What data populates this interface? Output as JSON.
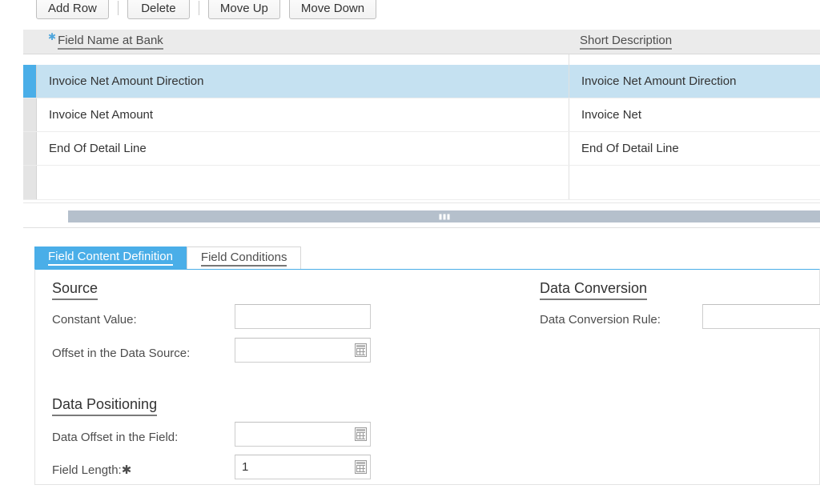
{
  "toolbar": {
    "buttons": [
      {
        "label": "Add Row",
        "name": "add-row-button"
      },
      {
        "label": "Delete",
        "name": "delete-button"
      },
      {
        "label": "Move Up",
        "name": "move-up-button"
      },
      {
        "label": "Move Down",
        "name": "move-down-button"
      }
    ]
  },
  "table": {
    "columns": [
      {
        "label": "Field Name at Bank",
        "required": true
      },
      {
        "label": "Short Description",
        "required": false
      }
    ],
    "rows": [
      {
        "field_name": "Invoice Net Amount Direction",
        "short_description": "Invoice Net Amount Direction",
        "selected": true
      },
      {
        "field_name": "Invoice Net Amount",
        "short_description": "Invoice Net",
        "selected": false
      },
      {
        "field_name": "End Of Detail Line",
        "short_description": "End Of Detail Line",
        "selected": false
      },
      {
        "field_name": "",
        "short_description": "",
        "selected": false
      }
    ],
    "scrollbar": {
      "orientation": "horizontal"
    }
  },
  "tabs": [
    {
      "label": "Field Content Definition",
      "active": true
    },
    {
      "label": "Field Conditions",
      "active": false
    }
  ],
  "form": {
    "source": {
      "title": "Source",
      "constant_value": {
        "label": "Constant Value:",
        "value": "",
        "has_value_help": false
      },
      "offset_in_data_source": {
        "label": "Offset in the Data Source:",
        "value": "",
        "has_value_help": true
      }
    },
    "data_conversion": {
      "title": "Data Conversion",
      "rule": {
        "label": "Data Conversion Rule:",
        "value": "",
        "has_value_help": false
      }
    },
    "data_positioning": {
      "title": "Data Positioning",
      "data_offset_in_field": {
        "label": "Data Offset in the Field:",
        "value": "",
        "has_value_help": true
      },
      "field_length": {
        "label": "Field Length:",
        "value": "1",
        "required": true,
        "has_value_help": true
      }
    }
  },
  "colors": {
    "accent": "#4aaee8",
    "selected_row": "#c5e1f1",
    "required_star": "#4fa6dd",
    "header_bg": "#ebebeb",
    "gutter": "#e4e4e4",
    "scrollbar_thumb": "#b5c0cc"
  }
}
